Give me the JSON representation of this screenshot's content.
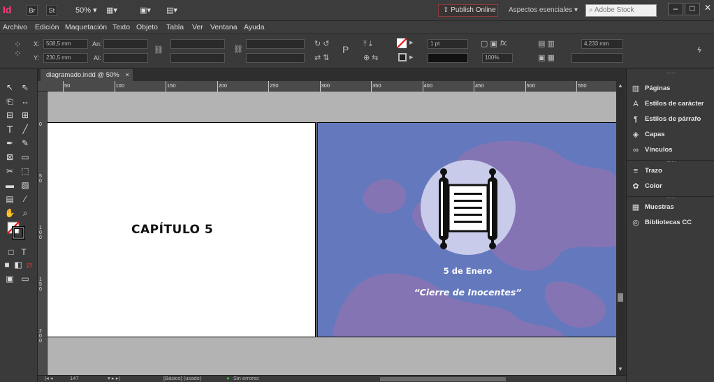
{
  "titlebar": {
    "app_logo": "Id",
    "bridge": "Br",
    "stock": "St",
    "zoom": "50%",
    "publish_online": "Publish Online",
    "workspace": "Aspectos esenciales",
    "stock_search_placeholder": "Adobe Stock"
  },
  "menu": [
    "Archivo",
    "Edición",
    "Maquetación",
    "Texto",
    "Objeto",
    "Tabla",
    "Ver",
    "Ventana",
    "Ayuda"
  ],
  "controls": {
    "x_label": "X:",
    "x_value": "508,5 mm",
    "y_label": "Y:",
    "y_value": "230,5 mm",
    "w_label": "An:",
    "h_label": "Al:",
    "stroke_weight": "1 pt",
    "opacity": "100%",
    "gutter": "4,233 mm"
  },
  "document": {
    "tab_label": "diagramado.indd @ 50%",
    "tab_close": "×"
  },
  "ruler": {
    "h_ticks": [
      "50",
      "100",
      "150",
      "200",
      "250",
      "300",
      "350",
      "400",
      "450",
      "500",
      "550"
    ],
    "v_ticks": [
      "0",
      "5\n0",
      "1\n0\n0",
      "1\n5\n0",
      "2\n0\n0"
    ]
  },
  "page_left": {
    "heading": "CAPÍTULO 5"
  },
  "page_right": {
    "date": "5 de Enero",
    "subtitle": "“Cierre de Inocentes”",
    "colors": {
      "background": "#6479bd",
      "blob": "#8574b4",
      "circle": "#c8cbe9"
    }
  },
  "status": {
    "page_number": "147",
    "master": "[Básico] (usado)",
    "preflight": "Sin errores"
  },
  "panels": [
    {
      "label": "Páginas",
      "icon": "pages-icon",
      "glyph": "▥"
    },
    {
      "label": "Estilos de carácter",
      "icon": "character-styles-icon",
      "glyph": "A"
    },
    {
      "label": "Estilos de párrafo",
      "icon": "paragraph-styles-icon",
      "glyph": "¶"
    },
    {
      "label": "Capas",
      "icon": "layers-icon",
      "glyph": "◈"
    },
    {
      "label": "Vínculos",
      "icon": "links-icon",
      "glyph": "∞"
    },
    {
      "label": "Trazo",
      "icon": "stroke-icon",
      "glyph": "≡"
    },
    {
      "label": "Color",
      "icon": "color-icon",
      "glyph": "✿"
    },
    {
      "label": "Muestras",
      "icon": "swatches-icon",
      "glyph": "▦"
    },
    {
      "label": "Bibliotecas CC",
      "icon": "cc-libraries-icon",
      "glyph": "◎"
    }
  ]
}
